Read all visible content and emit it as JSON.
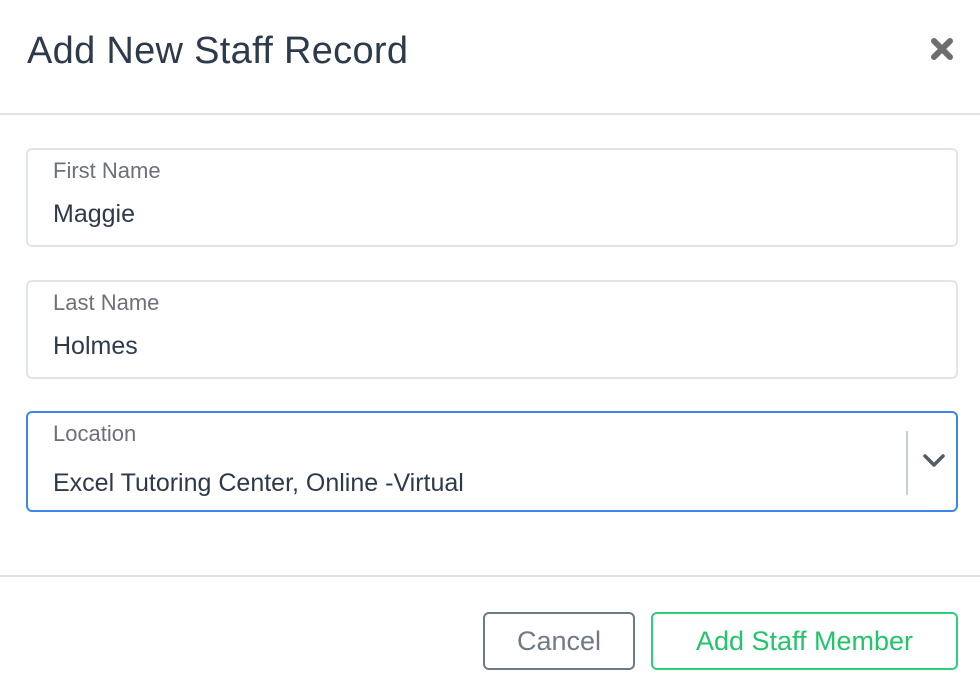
{
  "header": {
    "title": "Add New Staff Record",
    "close_icon": "close-icon"
  },
  "form": {
    "first_name": {
      "label": "First Name",
      "value": "Maggie"
    },
    "last_name": {
      "label": "Last Name",
      "value": "Holmes"
    },
    "location": {
      "label": "Location",
      "value": "Excel Tutoring Center, Online -Virtual",
      "icon": "chevron-down-icon"
    }
  },
  "footer": {
    "cancel_label": "Cancel",
    "submit_label": "Add Staff Member"
  },
  "colors": {
    "title": "#2d3a4b",
    "focus_border": "#3b86e8",
    "submit_accent": "#22c46c",
    "cancel_gray": "#6f7a88"
  }
}
